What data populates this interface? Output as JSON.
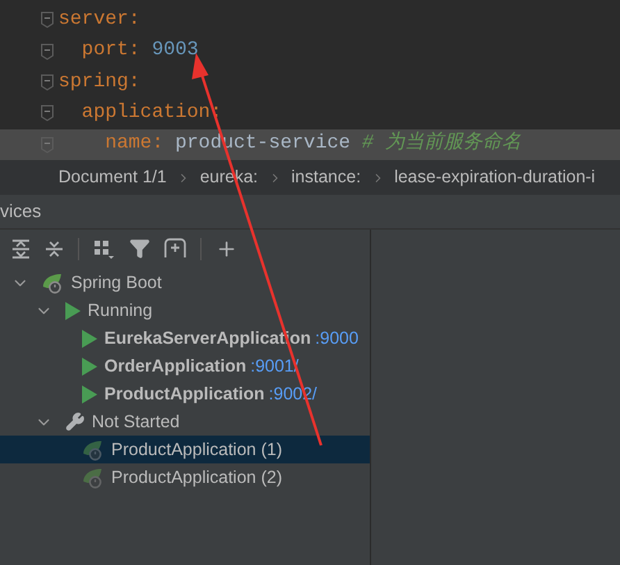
{
  "editor": {
    "lines": [
      {
        "key": "server:",
        "children": [
          {
            "key": "port:",
            "value": "9003",
            "highlighted": false
          }
        ],
        "highlighted": false
      },
      {
        "key": "spring:",
        "highlighted": false,
        "children": [
          {
            "key": "application:",
            "highlighted": false,
            "children": [
              {
                "key": "name:",
                "value": "product-service",
                "comment": "# 为当前服务命名",
                "highlighted": true
              }
            ]
          }
        ]
      }
    ]
  },
  "breadcrumb": [
    "Document 1/1",
    "eureka:",
    "instance:",
    "lease-expiration-duration-i"
  ],
  "services": {
    "title": "vices",
    "tree": [
      {
        "label": "Spring Boot",
        "kind": "spring",
        "expanded": true,
        "children": [
          {
            "label": "Running",
            "kind": "running",
            "expanded": true,
            "children": [
              {
                "label": "EurekaServerApplication",
                "port": ":9000",
                "kind": "running_app",
                "selected": false
              },
              {
                "label": "OrderApplication",
                "port": ":9001/",
                "kind": "running_app",
                "selected": false
              },
              {
                "label": "ProductApplication",
                "port": ":9002/",
                "kind": "running_app",
                "selected": false
              }
            ]
          },
          {
            "label": "Not Started",
            "kind": "not_started",
            "expanded": true,
            "children": [
              {
                "label": "ProductApplication (1)",
                "kind": "stopped_app",
                "selected": true
              },
              {
                "label": "ProductApplication (2)",
                "kind": "stopped_app",
                "selected": false
              }
            ]
          }
        ]
      }
    ]
  }
}
